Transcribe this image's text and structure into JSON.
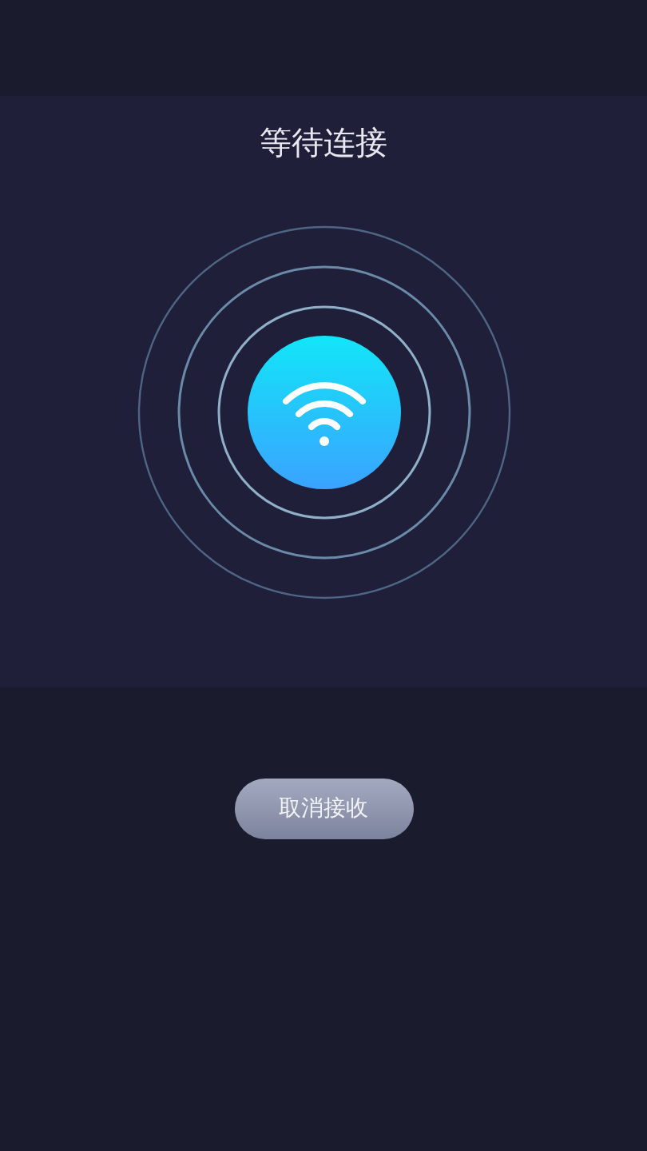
{
  "title": "等待连接",
  "cancel_button": {
    "label": "取消接收"
  }
}
